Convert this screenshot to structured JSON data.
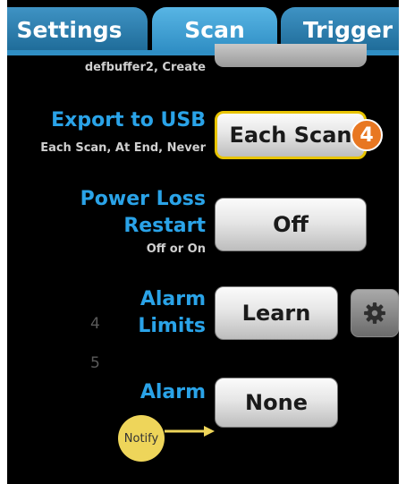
{
  "tabs": [
    {
      "label": "Settings"
    },
    {
      "label": "Scan"
    },
    {
      "label": "Trigger"
    }
  ],
  "buffer": {
    "sub": "defbuffer2, Create"
  },
  "export_usb": {
    "label": "Export to USB",
    "sub": "Each Scan, At End, Never",
    "value": "Each Scan",
    "badge": "4"
  },
  "power_loss": {
    "label_line1": "Power Loss",
    "label_line2": "Restart",
    "sub": "Off or On",
    "value": "Off"
  },
  "alarm_limits": {
    "label_line1": "Alarm",
    "label_line2": "Limits",
    "value": "Learn"
  },
  "alarm": {
    "label": "Alarm",
    "value": "None"
  },
  "ghost_numbers": [
    "4",
    "5"
  ],
  "callout": {
    "label": "Notify"
  },
  "colors": {
    "accent": "#2aa3e8",
    "tab": "#2f8ec4",
    "highlight_border": "#e8c400",
    "badge": "#e87722",
    "callout": "#eed55a"
  },
  "icons": {
    "settings_button": "gear-icon",
    "arrow": "arrow-right-icon"
  }
}
